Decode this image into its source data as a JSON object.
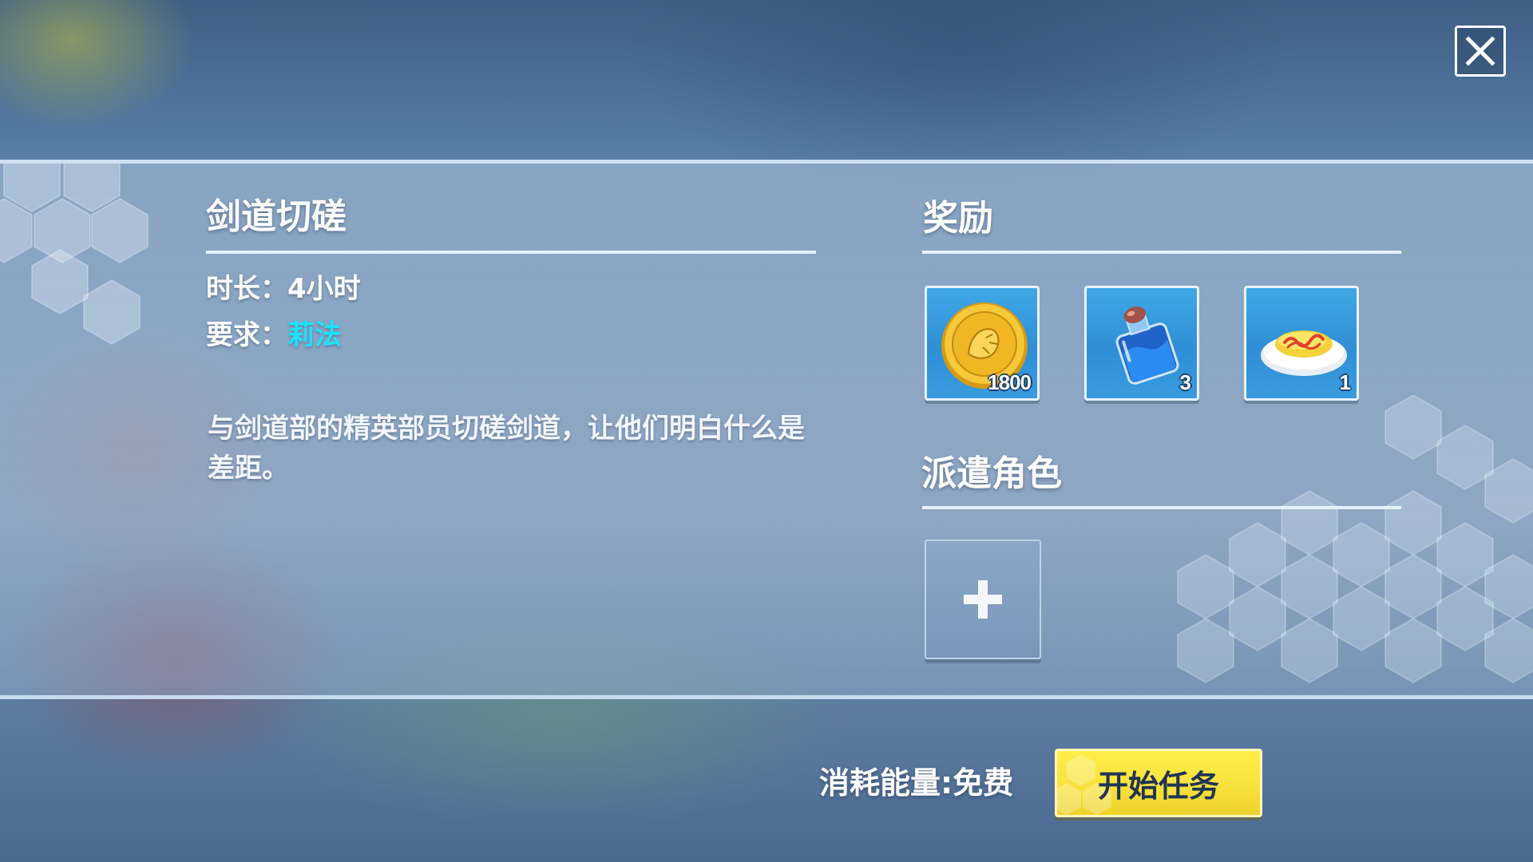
{
  "close_icon": "close-icon",
  "mission": {
    "title": "剑道切磋",
    "duration_label": "时长：",
    "duration_value": "4小时",
    "requirement_label": "要求：",
    "requirement_value": "莉法",
    "description": "与剑道部的精英部员切磋剑道，让他们明白什么是差距。"
  },
  "rewards": {
    "title": "奖励",
    "items": [
      {
        "icon": "gold-coin-icon",
        "quantity": "1800"
      },
      {
        "icon": "potion-bottle-icon",
        "quantity": "3"
      },
      {
        "icon": "omelet-rice-icon",
        "quantity": "1"
      }
    ]
  },
  "dispatch": {
    "title": "派遣角色",
    "add_icon": "plus-icon"
  },
  "footer": {
    "energy_cost": "消耗能量:免费",
    "start_button": "开始任务"
  },
  "colors": {
    "requirement_highlight": "#19e3ff",
    "start_button": "#f8e03a",
    "start_button_text": "#1f3553"
  }
}
